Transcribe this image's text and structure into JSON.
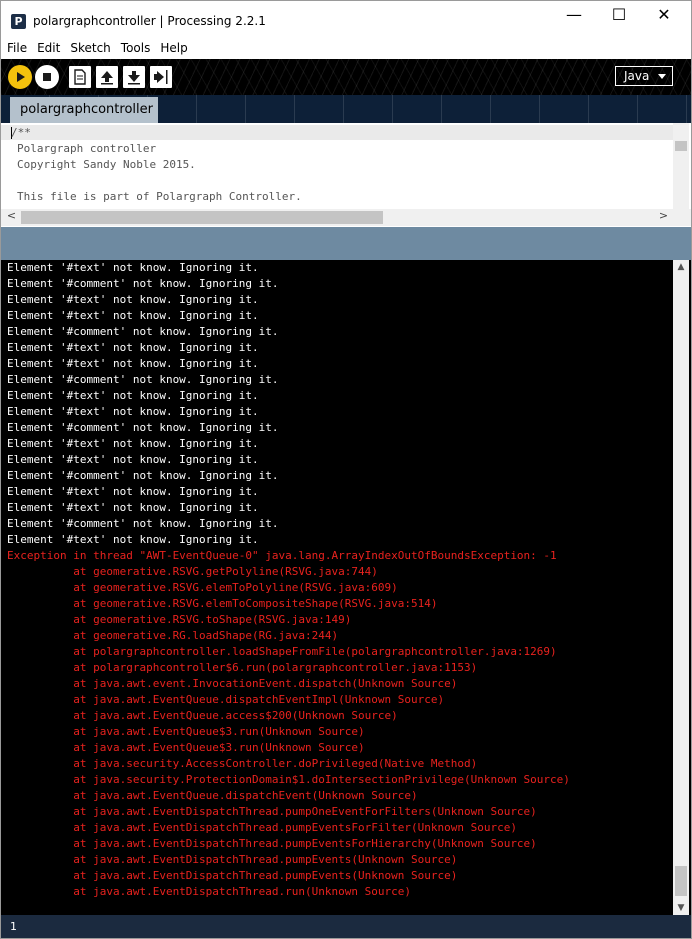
{
  "window": {
    "title": "polargraphcontroller | Processing 2.2.1",
    "app_icon_letter": "P",
    "minimize": "—",
    "maximize": "☐",
    "close": "✕"
  },
  "menu": [
    "File",
    "Edit",
    "Sketch",
    "Tools",
    "Help"
  ],
  "toolbar": {
    "mode": "Java",
    "colors": {
      "run": "#f4c20d",
      "background": "#000000"
    }
  },
  "tabs": [
    {
      "label": "polargraphcontroller",
      "active": true
    }
  ],
  "editor": {
    "lines": [
      "/**",
      "Polargraph controller",
      "Copyright Sandy Noble 2015.",
      "",
      "This file is part of Polargraph Controller."
    ]
  },
  "console": {
    "output": [
      "Element '#text' not know. Ignoring it.",
      "Element '#comment' not know. Ignoring it.",
      "Element '#text' not know. Ignoring it.",
      "Element '#text' not know. Ignoring it.",
      "Element '#comment' not know. Ignoring it.",
      "Element '#text' not know. Ignoring it.",
      "Element '#text' not know. Ignoring it.",
      "Element '#comment' not know. Ignoring it.",
      "Element '#text' not know. Ignoring it.",
      "Element '#text' not know. Ignoring it.",
      "Element '#comment' not know. Ignoring it.",
      "Element '#text' not know. Ignoring it.",
      "Element '#text' not know. Ignoring it.",
      "Element '#comment' not know. Ignoring it.",
      "Element '#text' not know. Ignoring it.",
      "Element '#text' not know. Ignoring it.",
      "Element '#comment' not know. Ignoring it.",
      "Element '#text' not know. Ignoring it."
    ],
    "error": [
      "Exception in thread \"AWT-EventQueue-0\" java.lang.ArrayIndexOutOfBoundsException: -1",
      "          at geomerative.RSVG.getPolyline(RSVG.java:744)",
      "          at geomerative.RSVG.elemToPolyline(RSVG.java:609)",
      "          at geomerative.RSVG.elemToCompositeShape(RSVG.java:514)",
      "          at geomerative.RSVG.toShape(RSVG.java:149)",
      "          at geomerative.RG.loadShape(RG.java:244)",
      "          at polargraphcontroller.loadShapeFromFile(polargraphcontroller.java:1269)",
      "          at polargraphcontroller$6.run(polargraphcontroller.java:1153)",
      "          at java.awt.event.InvocationEvent.dispatch(Unknown Source)",
      "          at java.awt.EventQueue.dispatchEventImpl(Unknown Source)",
      "          at java.awt.EventQueue.access$200(Unknown Source)",
      "          at java.awt.EventQueue$3.run(Unknown Source)",
      "          at java.awt.EventQueue$3.run(Unknown Source)",
      "          at java.security.AccessController.doPrivileged(Native Method)",
      "          at java.security.ProtectionDomain$1.doIntersectionPrivilege(Unknown Source)",
      "          at java.awt.EventQueue.dispatchEvent(Unknown Source)",
      "          at java.awt.EventDispatchThread.pumpOneEventForFilters(Unknown Source)",
      "          at java.awt.EventDispatchThread.pumpEventsForFilter(Unknown Source)",
      "          at java.awt.EventDispatchThread.pumpEventsForHierarchy(Unknown Source)",
      "          at java.awt.EventDispatchThread.pumpEvents(Unknown Source)",
      "          at java.awt.EventDispatchThread.pumpEvents(Unknown Source)",
      "          at java.awt.EventDispatchThread.run(Unknown Source)"
    ],
    "colors": {
      "output": "#ffffff",
      "error": "#e8221e",
      "background": "#000000"
    }
  },
  "status": {
    "line_number": "1"
  }
}
